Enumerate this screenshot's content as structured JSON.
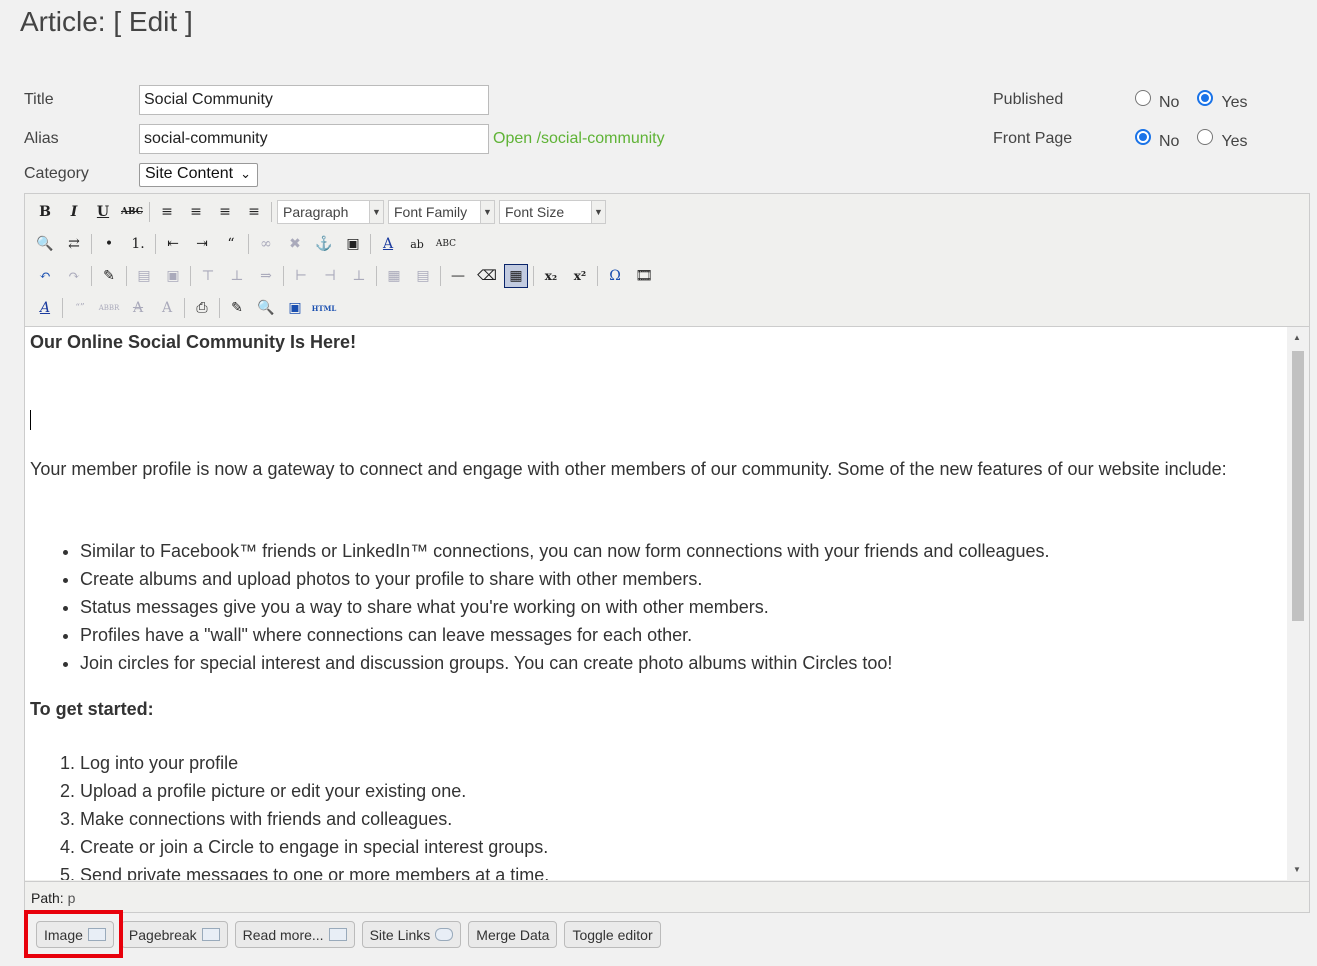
{
  "page_title": "Article: [ Edit ]",
  "form": {
    "title_label": "Title",
    "title_value": "Social Community",
    "alias_label": "Alias",
    "alias_value": "social-community",
    "alias_link": "Open /social-community",
    "category_label": "Category",
    "category_value": "Site Content",
    "published_label": "Published",
    "front_page_label": "Front Page",
    "no_label": "No",
    "yes_label": "Yes"
  },
  "toolbar": {
    "paragraph": "Paragraph",
    "font_family": "Font Family",
    "font_size": "Font Size"
  },
  "content": {
    "heading": "Our Online Social Community Is Here!",
    "intro": "Your member profile is now a gateway to connect and engage with other members of our community. Some of the new features of our website include:",
    "features": [
      "Similar to Facebook™ friends or LinkedIn™ connections, you can now form connections with your friends and colleagues.",
      "Create albums and upload photos to your profile to share with other members.",
      "Status messages give you a way to share what you're working on with other members.",
      "Profiles have a \"wall\" where connections can leave messages for each other.",
      "Join circles for special interest and discussion groups. You can create photo albums within Circles too!"
    ],
    "get_started": "To get started:",
    "steps": [
      "Log into your profile",
      "Upload a profile picture or edit your existing one.",
      "Make connections with friends and colleagues.",
      "Create or join a Circle to engage in special interest groups.",
      "Send private messages to one or more members at a time."
    ]
  },
  "status": {
    "path_label": "Path:",
    "path_value": "p"
  },
  "buttons": {
    "image": "Image",
    "pagebreak": "Pagebreak",
    "read_more": "Read more...",
    "site_links": "Site Links",
    "merge_data": "Merge Data",
    "toggle_editor": "Toggle editor"
  },
  "colors": {
    "highlight": "#e8000b",
    "link_green": "#5fb336",
    "radio_blue": "#1a73e8"
  }
}
